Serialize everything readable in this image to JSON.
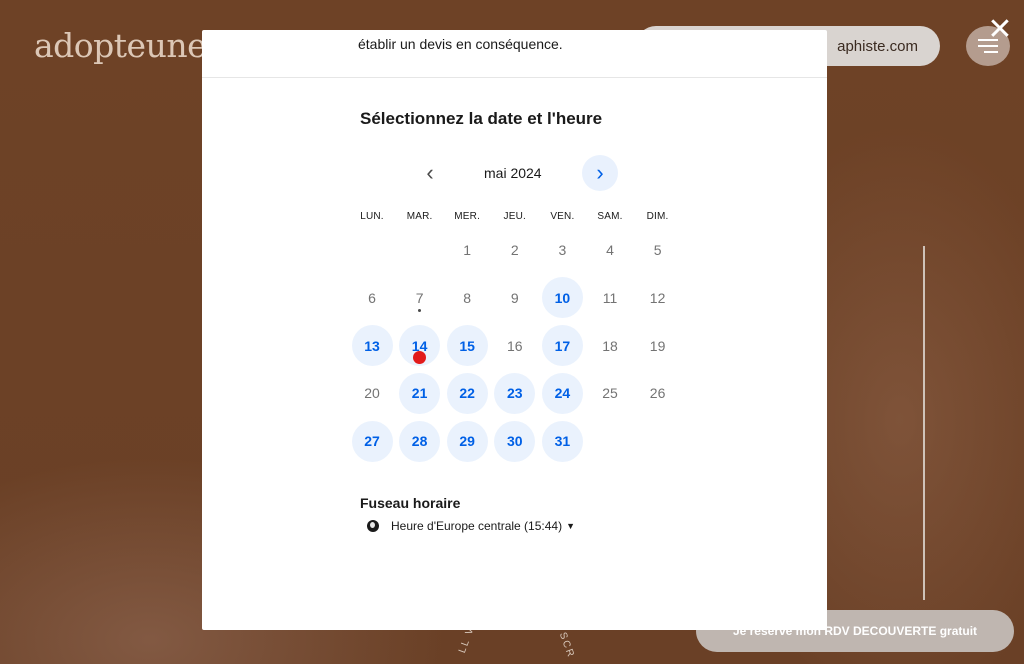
{
  "background": {
    "logo_text": "adopteuneg",
    "pill_text": "aphiste.com",
    "cta_text": "Je réserve mon RDV DECOUVERTE gratuit",
    "scroll_text_left": "LL VE",
    "scroll_text_right": "SCR",
    "close_icon": "close-icon",
    "menu_icon": "hamburger-icon"
  },
  "modal": {
    "top_text": "établir un devis en conséquence.",
    "section_title": "Sélectionnez la date et l'heure",
    "month_label": "mai 2024",
    "prev_icon": "‹",
    "next_icon": "›",
    "weekdays": [
      "LUN.",
      "MAR.",
      "MER.",
      "JEU.",
      "VEN.",
      "SAM.",
      "DIM."
    ],
    "days": [
      {
        "label": "1",
        "available": false
      },
      {
        "label": "2",
        "available": false
      },
      {
        "label": "3",
        "available": false
      },
      {
        "label": "4",
        "available": false
      },
      {
        "label": "5",
        "available": false
      },
      {
        "label": "6",
        "available": false
      },
      {
        "label": "7",
        "available": false,
        "today": true
      },
      {
        "label": "8",
        "available": false
      },
      {
        "label": "9",
        "available": false
      },
      {
        "label": "10",
        "available": true
      },
      {
        "label": "11",
        "available": false
      },
      {
        "label": "12",
        "available": false
      },
      {
        "label": "13",
        "available": true
      },
      {
        "label": "14",
        "available": true,
        "cursor": true
      },
      {
        "label": "15",
        "available": true
      },
      {
        "label": "16",
        "available": false
      },
      {
        "label": "17",
        "available": true
      },
      {
        "label": "18",
        "available": false
      },
      {
        "label": "19",
        "available": false
      },
      {
        "label": "20",
        "available": false
      },
      {
        "label": "21",
        "available": true
      },
      {
        "label": "22",
        "available": true
      },
      {
        "label": "23",
        "available": true
      },
      {
        "label": "24",
        "available": true
      },
      {
        "label": "25",
        "available": false
      },
      {
        "label": "26",
        "available": false
      },
      {
        "label": "27",
        "available": true
      },
      {
        "label": "28",
        "available": true
      },
      {
        "label": "29",
        "available": true
      },
      {
        "label": "30",
        "available": true
      },
      {
        "label": "31",
        "available": true
      }
    ],
    "first_weekday_index": 2,
    "timezone_title": "Fuseau horaire",
    "timezone_value": "Heure d'Europe centrale (15:44)",
    "colors": {
      "available_text": "#0060e6",
      "available_bg": "#eaf2fd",
      "cursor": "#e21b1b"
    }
  }
}
